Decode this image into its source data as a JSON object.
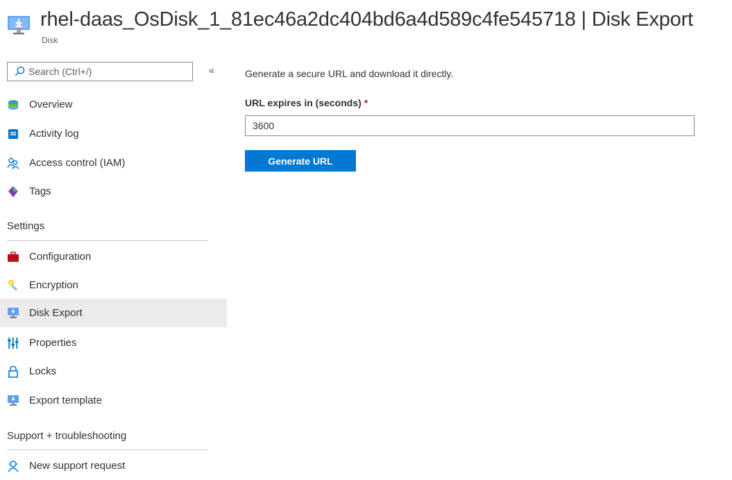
{
  "header": {
    "title": "rhel-daas_OsDisk_1_81ec46a2dc404bd6a4d589c4fe545718 | Disk Export",
    "subtitle": "Disk",
    "icon": "disk-export-icon"
  },
  "sidebar": {
    "search_placeholder": "Search (Ctrl+/)",
    "collapse_label": "«",
    "items_top": [
      {
        "label": "Overview",
        "icon": "overview-icon"
      },
      {
        "label": "Activity log",
        "icon": "activity-log-icon"
      },
      {
        "label": "Access control (IAM)",
        "icon": "iam-icon"
      },
      {
        "label": "Tags",
        "icon": "tag-icon"
      }
    ],
    "settings_header": "Settings",
    "items_settings": [
      {
        "label": "Configuration",
        "icon": "toolbox-icon"
      },
      {
        "label": "Encryption",
        "icon": "key-icon"
      },
      {
        "label": "Disk Export",
        "icon": "disk-export-icon",
        "selected": true
      },
      {
        "label": "Properties",
        "icon": "properties-icon"
      },
      {
        "label": "Locks",
        "icon": "lock-icon"
      },
      {
        "label": "Export template",
        "icon": "export-template-icon"
      }
    ],
    "support_header": "Support + troubleshooting",
    "items_support": [
      {
        "label": "New support request",
        "icon": "support-icon"
      }
    ]
  },
  "main": {
    "description": "Generate a secure URL and download it directly.",
    "field_label": "URL expires in (seconds)",
    "required_marker": "*",
    "field_value": "3600",
    "button_label": "Generate URL"
  },
  "colors": {
    "accent": "#0078d4",
    "selected_bg": "#edebe9",
    "required": "#a4262c"
  }
}
